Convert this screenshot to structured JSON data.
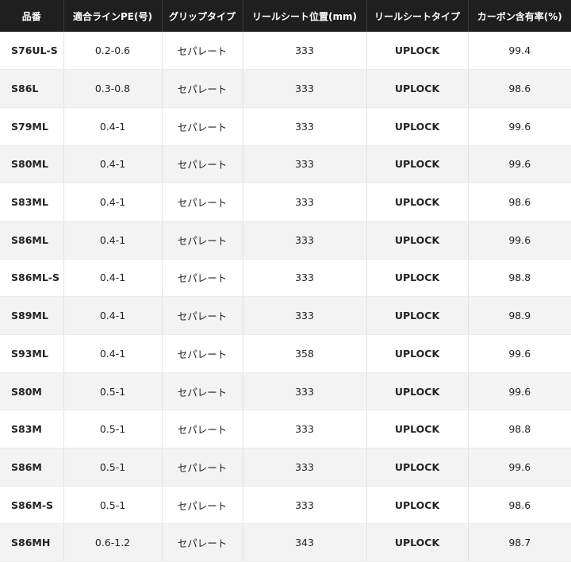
{
  "table": {
    "headers": [
      "品番",
      "適合ラインPE(号)",
      "グリップタイプ",
      "リールシート位置(mm)",
      "リールシートタイプ",
      "カーボン含有率(%)"
    ],
    "rows": [
      {
        "model": "S76UL-S",
        "line_pe": "0.2-0.6",
        "grip": "セパレート",
        "seat_pos": "333",
        "seat_type": "UPLOCK",
        "carbon": "99.4"
      },
      {
        "model": "S86L",
        "line_pe": "0.3-0.8",
        "grip": "セパレート",
        "seat_pos": "333",
        "seat_type": "UPLOCK",
        "carbon": "98.6"
      },
      {
        "model": "S79ML",
        "line_pe": "0.4-1",
        "grip": "セパレート",
        "seat_pos": "333",
        "seat_type": "UPLOCK",
        "carbon": "99.6"
      },
      {
        "model": "S80ML",
        "line_pe": "0.4-1",
        "grip": "セパレート",
        "seat_pos": "333",
        "seat_type": "UPLOCK",
        "carbon": "99.6"
      },
      {
        "model": "S83ML",
        "line_pe": "0.4-1",
        "grip": "セパレート",
        "seat_pos": "333",
        "seat_type": "UPLOCK",
        "carbon": "98.6"
      },
      {
        "model": "S86ML",
        "line_pe": "0.4-1",
        "grip": "セパレート",
        "seat_pos": "333",
        "seat_type": "UPLOCK",
        "carbon": "99.6"
      },
      {
        "model": "S86ML-S",
        "line_pe": "0.4-1",
        "grip": "セパレート",
        "seat_pos": "333",
        "seat_type": "UPLOCK",
        "carbon": "98.8"
      },
      {
        "model": "S89ML",
        "line_pe": "0.4-1",
        "grip": "セパレート",
        "seat_pos": "333",
        "seat_type": "UPLOCK",
        "carbon": "98.9"
      },
      {
        "model": "S93ML",
        "line_pe": "0.4-1",
        "grip": "セパレート",
        "seat_pos": "358",
        "seat_type": "UPLOCK",
        "carbon": "99.6"
      },
      {
        "model": "S80M",
        "line_pe": "0.5-1",
        "grip": "セパレート",
        "seat_pos": "333",
        "seat_type": "UPLOCK",
        "carbon": "99.6"
      },
      {
        "model": "S83M",
        "line_pe": "0.5-1",
        "grip": "セパレート",
        "seat_pos": "333",
        "seat_type": "UPLOCK",
        "carbon": "98.8"
      },
      {
        "model": "S86M",
        "line_pe": "0.5-1",
        "grip": "セパレート",
        "seat_pos": "333",
        "seat_type": "UPLOCK",
        "carbon": "99.6"
      },
      {
        "model": "S86M-S",
        "line_pe": "0.5-1",
        "grip": "セパレート",
        "seat_pos": "333",
        "seat_type": "UPLOCK",
        "carbon": "98.6"
      },
      {
        "model": "S86MH",
        "line_pe": "0.6-1.2",
        "grip": "セパレート",
        "seat_pos": "343",
        "seat_type": "UPLOCK",
        "carbon": "98.7"
      }
    ]
  },
  "colors": {
    "header_bg": "#1f1f1f",
    "header_text": "#ffffff",
    "row_alt_bg": "#f3f3f3",
    "text": "#222222"
  }
}
